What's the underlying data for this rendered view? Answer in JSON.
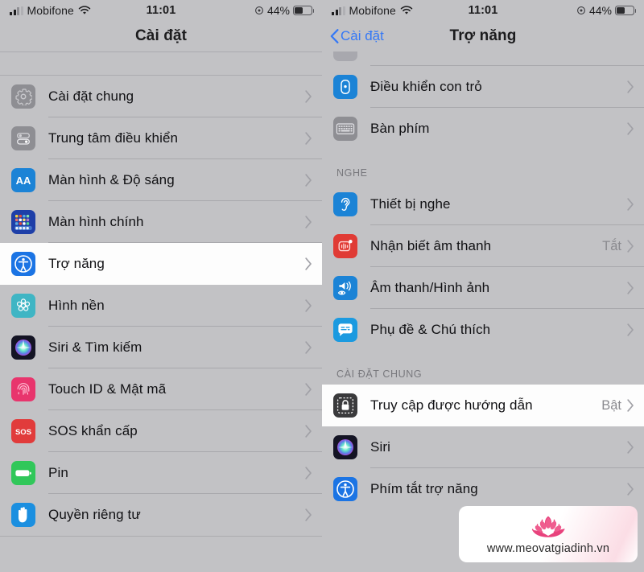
{
  "status_bar": {
    "carrier": "Mobifone",
    "time": "11:01",
    "battery_percent": "44%",
    "signal_icon": "signal-bars-icon",
    "wifi_icon": "wifi-icon",
    "location_icon": "location-services-icon",
    "battery_icon": "battery-icon"
  },
  "left_panel": {
    "nav_title": "Cài đặt",
    "items": [
      {
        "label": "Cài đặt chung",
        "icon": "gear-icon",
        "selected": false
      },
      {
        "label": "Trung tâm điều khiển",
        "icon": "control-center-icon",
        "selected": false
      },
      {
        "label": "Màn hình & Độ sáng",
        "icon": "display-brightness-icon",
        "selected": false
      },
      {
        "label": "Màn hình chính",
        "icon": "home-screen-icon",
        "selected": false
      },
      {
        "label": "Trợ năng",
        "icon": "accessibility-icon",
        "selected": true
      },
      {
        "label": "Hình nền",
        "icon": "wallpaper-icon",
        "selected": false
      },
      {
        "label": "Siri & Tìm kiếm",
        "icon": "siri-icon",
        "selected": false
      },
      {
        "label": "Touch ID & Mật mã",
        "icon": "touch-id-icon",
        "selected": false
      },
      {
        "label": "SOS khẩn cấp",
        "icon": "sos-icon",
        "selected": false
      },
      {
        "label": "Pin",
        "icon": "battery-app-icon",
        "selected": false
      },
      {
        "label": "Quyền riêng tư",
        "icon": "privacy-hand-icon",
        "selected": false
      }
    ]
  },
  "right_panel": {
    "back_label": "Cài đặt",
    "nav_title": "Trợ năng",
    "sections": [
      {
        "header": "",
        "items": [
          {
            "label": "Điều khiển con trỏ",
            "icon": "pointer-control-icon",
            "value": "",
            "selected": false
          },
          {
            "label": "Bàn phím",
            "icon": "keyboard-icon",
            "value": "",
            "selected": false
          }
        ]
      },
      {
        "header": "NGHE",
        "items": [
          {
            "label": "Thiết bị nghe",
            "icon": "hearing-devices-icon",
            "value": "",
            "selected": false
          },
          {
            "label": "Nhận biết âm thanh",
            "icon": "sound-recognition-icon",
            "value": "Tắt",
            "selected": false
          },
          {
            "label": "Âm thanh/Hình ảnh",
            "icon": "audio-visual-icon",
            "value": "",
            "selected": false
          },
          {
            "label": "Phụ đề & Chú thích",
            "icon": "subtitles-icon",
            "value": "",
            "selected": false
          }
        ]
      },
      {
        "header": "CÀI ĐẶT CHUNG",
        "items": [
          {
            "label": "Truy cập được hướng dẫn",
            "icon": "guided-access-icon",
            "value": "Bật",
            "selected": true
          },
          {
            "label": "Siri",
            "icon": "siri-icon",
            "value": "",
            "selected": false
          },
          {
            "label": "Phím tắt trợ năng",
            "icon": "accessibility-icon",
            "value": "",
            "selected": false
          }
        ]
      }
    ]
  },
  "watermark": {
    "url": "www.meovatgiadinh.vn",
    "logo_icon": "lotus-flower-icon"
  },
  "colors": {
    "background": "#c2c2c5",
    "selected_row": "#fdfdfd",
    "accent_blue": "#3478f6",
    "secondary_text": "#8a8a8f",
    "watermark_pink": "#e8427c"
  }
}
